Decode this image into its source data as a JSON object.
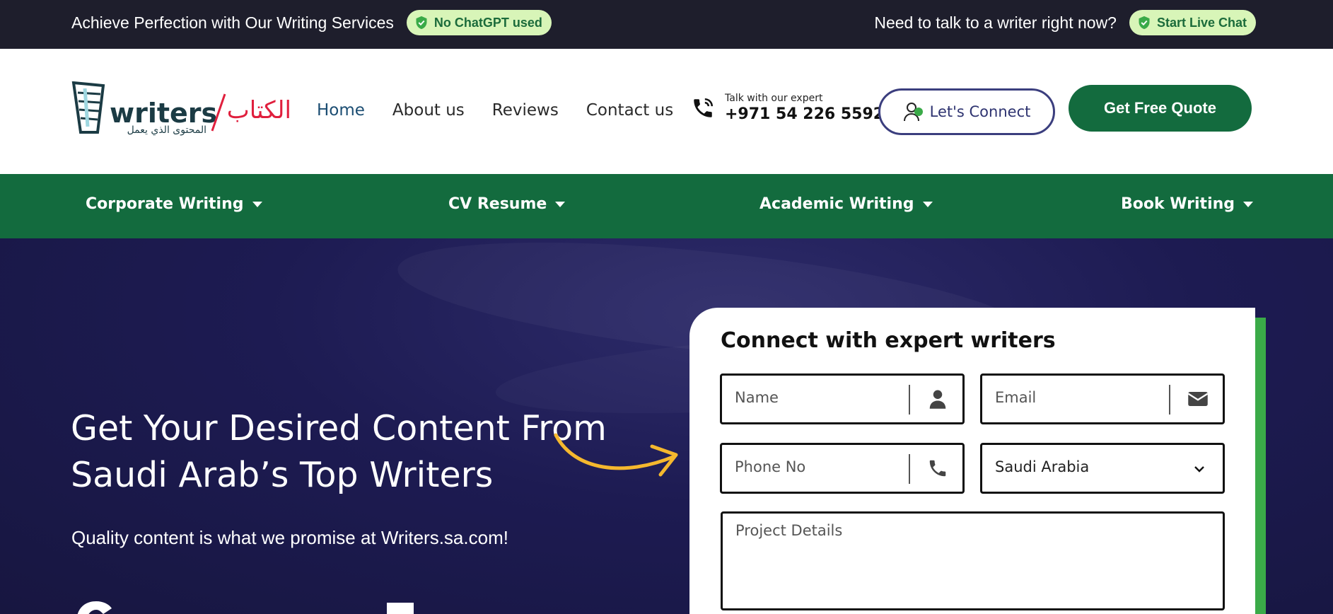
{
  "topbar": {
    "left_message": "Achieve Perfection with Our Writing Services",
    "left_badge": "No ChatGPT used",
    "right_message": "Need to talk to a writer right now?",
    "right_badge": "Start Live Chat"
  },
  "header": {
    "logo_text": "writers",
    "logo_arabic": "الكتاب",
    "logo_tagline": "المحتوى الذي يعمل",
    "nav": [
      "Home",
      "About us",
      "Reviews",
      "Contact us"
    ],
    "active_nav": "Home",
    "expert_label": "Talk with our expert",
    "expert_phone": "+971 54 226 5592",
    "connect_label": "Let's Connect",
    "quote_label": "Get Free Quote"
  },
  "services": [
    "Corporate Writing",
    "CV Resume",
    "Academic Writing",
    "Book Writing"
  ],
  "hero": {
    "title": "Get Your Desired Content From Saudi Arab’s Top Writers",
    "subtitle": "Quality content is what we promise at Writers.sa.com!"
  },
  "form": {
    "title": "Connect with expert writers",
    "name_placeholder": "Name",
    "email_placeholder": "Email",
    "phone_placeholder": "Phone No",
    "country_selected": "Saudi Arabia",
    "details_placeholder": "Project Details"
  },
  "colors": {
    "topbar_bg": "#1e1e2c",
    "badge_bg": "#d8f5b8",
    "brand_green": "#136b3e",
    "hero_bg": "#1d1b52",
    "accent_green": "#3aaa48",
    "connect_border": "#3b3e7e",
    "arrow_yellow": "#f5b82e"
  }
}
